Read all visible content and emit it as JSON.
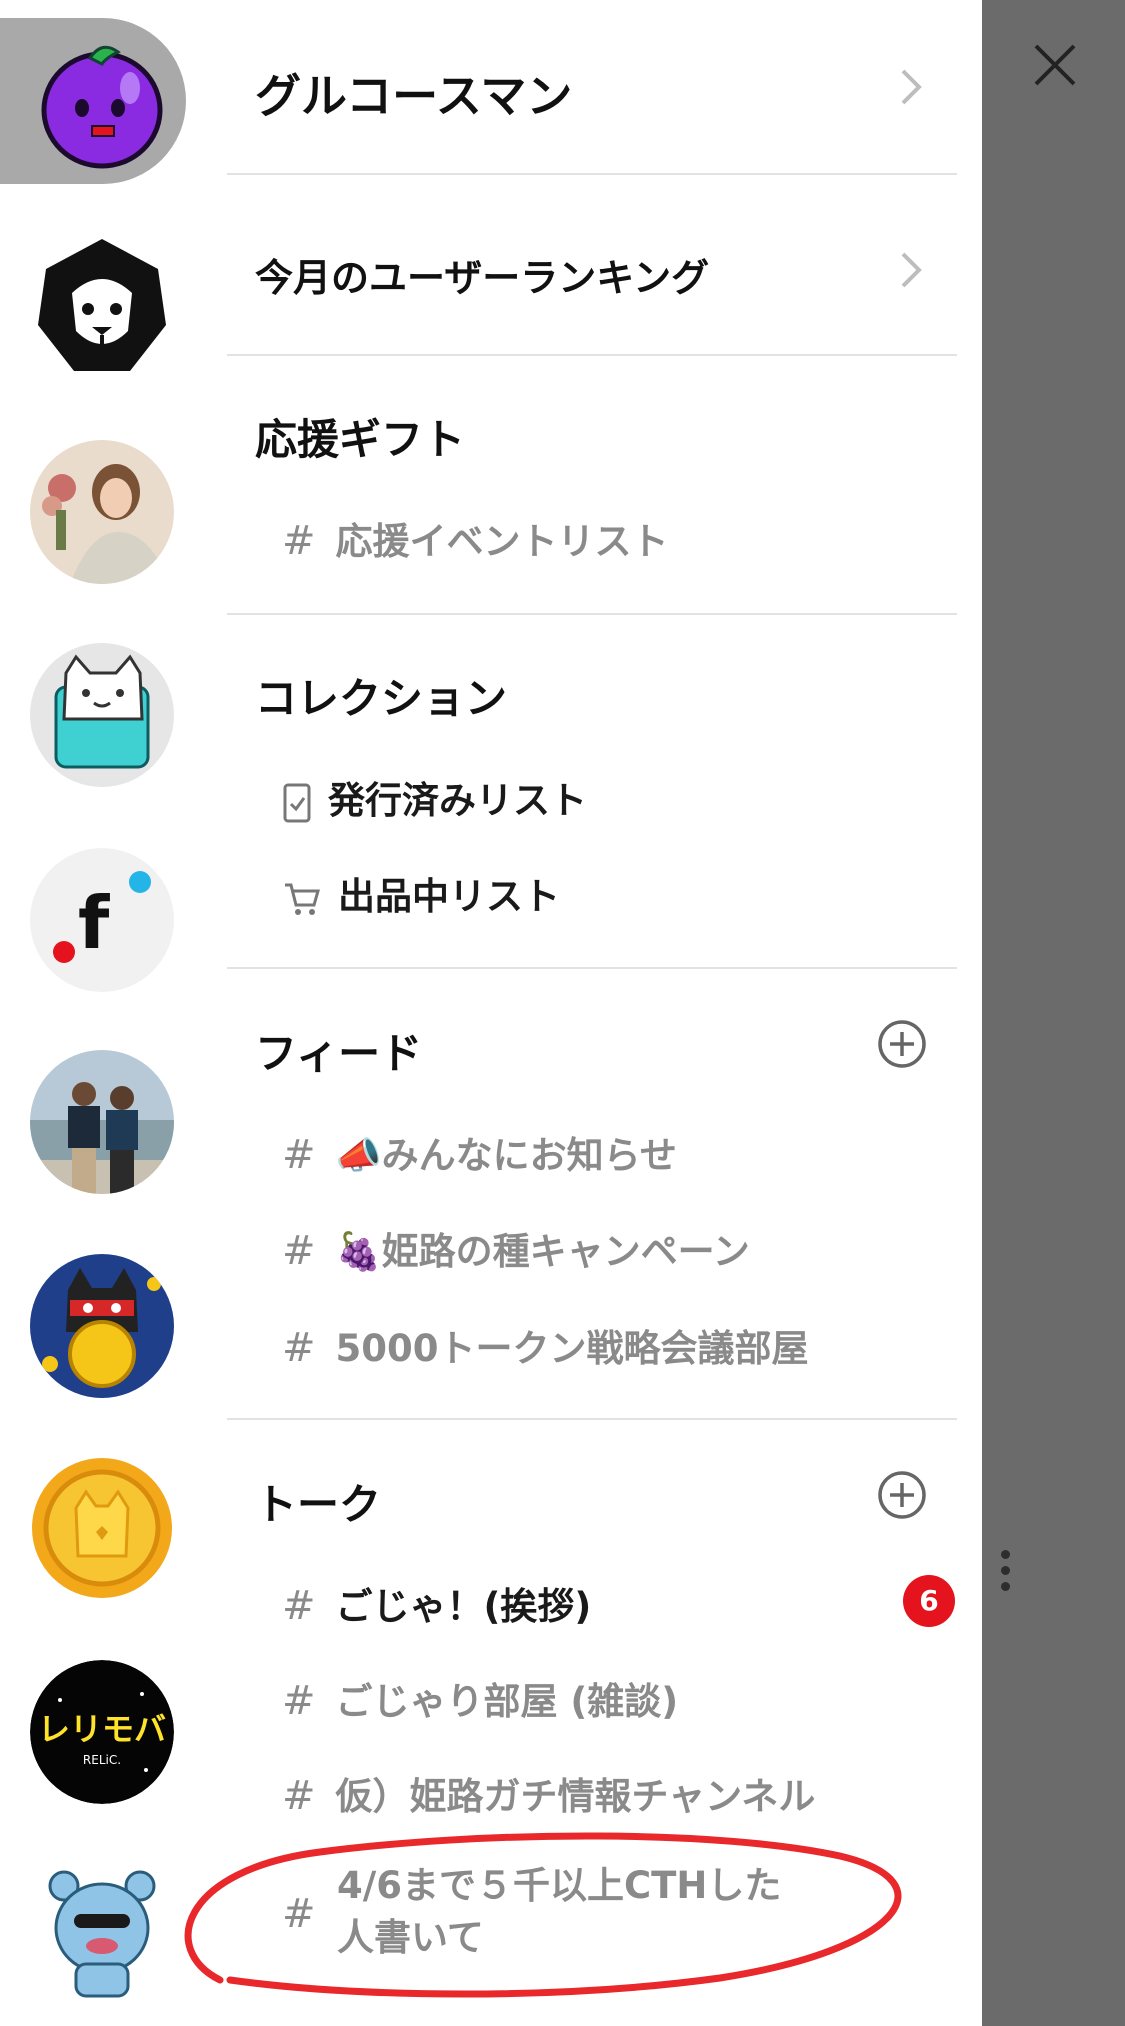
{
  "header": {
    "title": "グルコースマン"
  },
  "ranking": {
    "label": "今月のユーザーランキング"
  },
  "support": {
    "title": "応援ギフト",
    "items": [
      {
        "hash": "#",
        "label": "応援イベントリスト"
      }
    ]
  },
  "collection": {
    "title": "コレクション",
    "items": [
      {
        "icon": "checklist-icon",
        "label": "発行済みリスト"
      },
      {
        "icon": "cart-icon",
        "label": "出品中リスト"
      }
    ]
  },
  "feed": {
    "title": "フィード",
    "items": [
      {
        "hash": "#",
        "emoji": "📣",
        "label": "みんなにお知らせ"
      },
      {
        "hash": "#",
        "emoji": "🍇",
        "label": "姫路の種キャンペーン"
      },
      {
        "hash": "#",
        "label": "5000トークン戦略会議部屋"
      }
    ]
  },
  "talk": {
    "title": "トーク",
    "items": [
      {
        "hash": "#",
        "label": "ごじゃ！(挨拶)",
        "badge": "6"
      },
      {
        "hash": "#",
        "label": "ごじゃり部屋 (雑談)"
      },
      {
        "hash": "#",
        "label": "仮）姫路ガチ情報チャンネル"
      },
      {
        "hash": "#",
        "label_line1": "4/6まで５千以上CTHした",
        "label_line2": "人書いて"
      }
    ]
  },
  "rail": {
    "texts": {
      "rerimoba": "レリモバ",
      "relic": "RELiC."
    }
  },
  "colors": {
    "overlay": "#6b6b6b",
    "badge": "#e4131d",
    "annotation": "#e8282b",
    "active_rail": "#a9a9a9"
  }
}
